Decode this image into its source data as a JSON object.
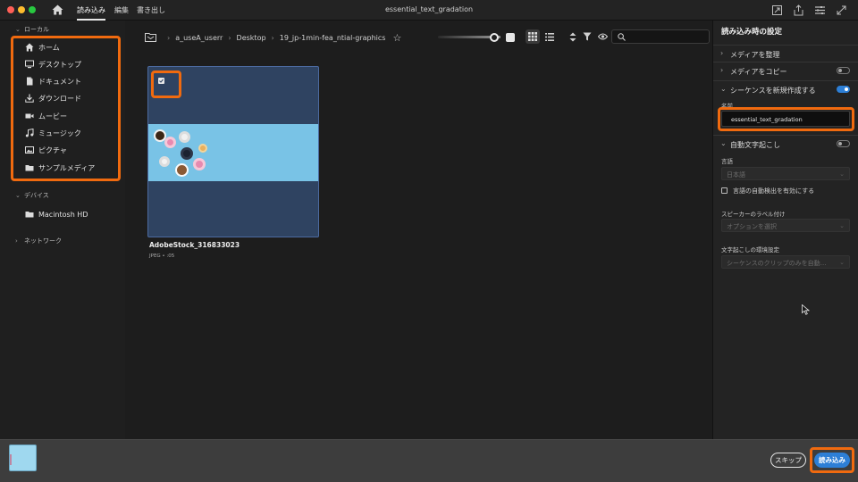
{
  "titlebar": {
    "tabs": [
      {
        "label": "読み込み",
        "active": true
      },
      {
        "label": "編集",
        "active": false
      },
      {
        "label": "書き出し",
        "active": false
      }
    ],
    "window_title": "essential_text_gradation",
    "icons": [
      "home-icon",
      "share-window-icon",
      "export-icon",
      "panels-icon",
      "fullscreen-icon"
    ]
  },
  "sidebar": {
    "local_label": "ローカル",
    "items": [
      {
        "label": "ホーム",
        "icon": "home-icon"
      },
      {
        "label": "デスクトップ",
        "icon": "desktop-icon"
      },
      {
        "label": "ドキュメント",
        "icon": "document-icon"
      },
      {
        "label": "ダウンロード",
        "icon": "download-icon"
      },
      {
        "label": "ムービー",
        "icon": "movie-icon"
      },
      {
        "label": "ミュージック",
        "icon": "music-icon"
      },
      {
        "label": "ピクチャ",
        "icon": "picture-icon"
      },
      {
        "label": "サンプルメディア",
        "icon": "folder-icon"
      }
    ],
    "devices_label": "デバイス",
    "devices": [
      {
        "label": "Macintosh HD",
        "icon": "folder-icon"
      }
    ],
    "network_label": "ネットワーク"
  },
  "browser": {
    "breadcrumb": [
      "a_useA_userr",
      "Desktop",
      "19_jp-1min-fea_ntial-graphics"
    ],
    "search": {
      "value": "",
      "placeholder": ""
    },
    "thumb_scale": 0.9,
    "files": [
      {
        "name": "AdobeStock_316833023",
        "meta": "JPEG • :05",
        "selected": true
      }
    ]
  },
  "import_settings": {
    "title": "読み込み時の設定",
    "organize_media": {
      "label": "メディアを整理"
    },
    "copy_media": {
      "label": "メディアをコピー",
      "enabled": false
    },
    "new_sequence": {
      "label": "シーケンスを新規作成する",
      "enabled": true
    },
    "name_label": "名前",
    "name_value": "essential_text_gradation",
    "auto_transcribe": {
      "label": "自動文字起こし",
      "enabled": false
    },
    "language_label": "言語",
    "language_value": "日本語",
    "auto_detect_label": "言語の自動検出を有効にする",
    "speaker_label": "スピーカーのラベル付け",
    "speaker_value": "オプションを選択",
    "transcribe_pref_label": "文字起こしの環境設定",
    "transcribe_pref_value": "シーケンスのクリップのみを自動…"
  },
  "footer": {
    "skip_label": "スキップ",
    "import_label": "読み込み"
  },
  "colors": {
    "accent": "#2d7fd6",
    "highlight": "#f06a0f",
    "thumb_bg": "#2f4361"
  }
}
